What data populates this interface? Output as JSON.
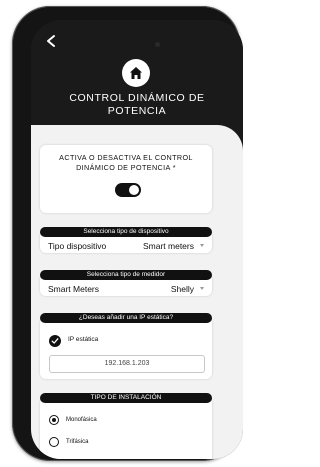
{
  "header": {
    "title": "CONTROL DINÁMICO DE\nPOTENCIA"
  },
  "toggle_card": {
    "label": "ACTIVA O DESACTIVA EL CONTROL\nDINÁMICO DE POTENCIA *",
    "state": "on"
  },
  "device_type": {
    "heading": "Selecciona tipo de dispositivo",
    "label": "Tipo dispositivo",
    "value": "Smart meters"
  },
  "meter_type": {
    "heading": "Selecciona tipo de medidor",
    "label": "Smart Meters",
    "value": "Shelly"
  },
  "static_ip": {
    "heading": "¿Deseas añadir una IP estática?",
    "checkbox_label": "IP estática",
    "checked": true,
    "ip_value": "192.168.1.203"
  },
  "installation": {
    "heading": "TIPO DE INSTALACIÓN",
    "options": [
      {
        "label": "Monofásica",
        "selected": true
      },
      {
        "label": "Trifásica",
        "selected": false
      }
    ]
  },
  "colors": {
    "header_bg": "#1a1a1a",
    "content_bg": "#f2f2f2",
    "accent": "#111111"
  }
}
